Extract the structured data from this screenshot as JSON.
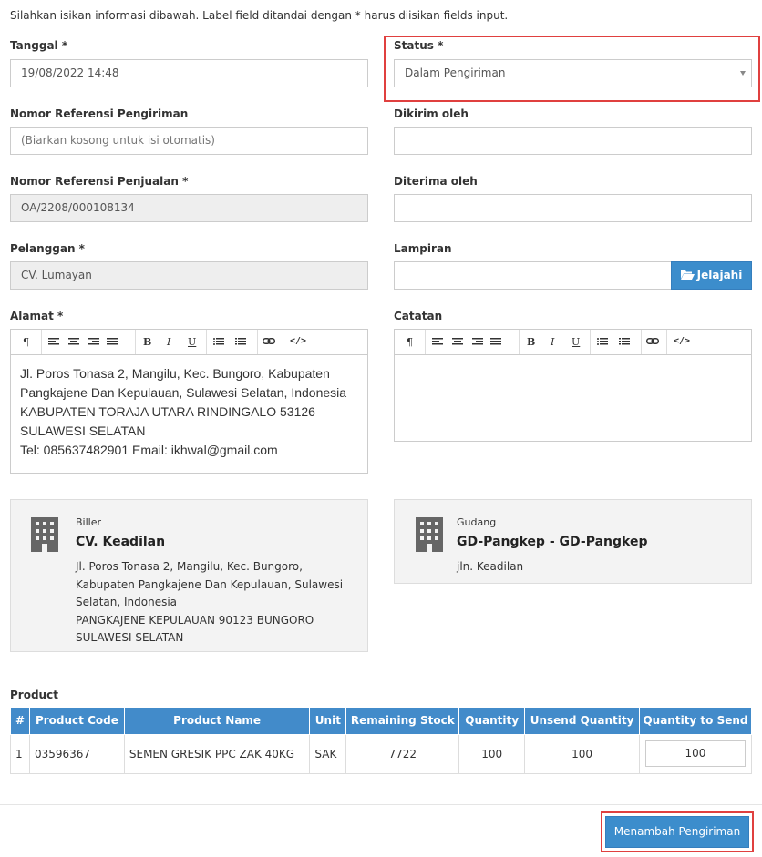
{
  "intro_text": "Silahkan isikan informasi dibawah. Label field ditandai dengan * harus diisikan fields input.",
  "fields": {
    "tanggal": {
      "label": "Tanggal *",
      "value": "19/08/2022 14:48"
    },
    "status": {
      "label": "Status *",
      "value": "Dalam Pengiriman"
    },
    "nomor_ref_pengiriman": {
      "label": "Nomor Referensi Pengiriman",
      "placeholder": "(Biarkan kosong untuk isi otomatis)"
    },
    "dikirim_oleh": {
      "label": "Dikirim oleh",
      "value": ""
    },
    "nomor_ref_penjualan": {
      "label": "Nomor Referensi Penjualan *",
      "value": "OA/2208/000108134"
    },
    "diterima_oleh": {
      "label": "Diterima oleh",
      "value": ""
    },
    "pelanggan": {
      "label": "Pelanggan *",
      "value": "CV. Lumayan"
    },
    "lampiran": {
      "label": "Lampiran",
      "browse_label": "Jelajahi"
    },
    "alamat": {
      "label": "Alamat *",
      "lines": [
        "Jl. Poros Tonasa 2, Mangilu, Kec. Bungoro, Kabupaten",
        "Pangkajene Dan Kepulauan, Sulawesi Selatan, Indonesia",
        "KABUPATEN TORAJA UTARA RINDINGALO 53126",
        "SULAWESI SELATAN",
        "Tel: 085637482901 Email: ikhwal@gmail.com"
      ]
    },
    "catatan": {
      "label": "Catatan"
    }
  },
  "toolbar": {
    "paragraph": "¶",
    "bold": "B",
    "italic": "I",
    "underline": "U",
    "code": "</>"
  },
  "biller": {
    "small_label": "Biller",
    "name": "CV. Keadilan",
    "address_lines": [
      "Jl. Poros Tonasa 2, Mangilu, Kec. Bungoro,",
      "Kabupaten Pangkajene Dan Kepulauan, Sulawesi",
      "Selatan, Indonesia",
      "PANGKAJENE KEPULAUAN 90123 BUNGORO",
      "SULAWESI SELATAN"
    ]
  },
  "gudang": {
    "small_label": "Gudang",
    "name": "GD-Pangkep - GD-Pangkep",
    "address": "jln. Keadilan"
  },
  "product": {
    "section_label": "Product",
    "columns": [
      "#",
      "Product Code",
      "Product Name",
      "Unit",
      "Remaining Stock",
      "Quantity",
      "Unsend Quantity",
      "Quantity to Send"
    ],
    "rows": [
      {
        "no": "1",
        "code": "03596367",
        "name": "SEMEN GRESIK PPC ZAK 40KG",
        "unit": "SAK",
        "remaining": "7722",
        "quantity": "100",
        "unsend": "100",
        "to_send": "100"
      }
    ]
  },
  "submit_label": "Menambah Pengiriman",
  "colors": {
    "primary": "#3c8dcc",
    "header": "#428bca",
    "highlight": "#e0403f"
  }
}
